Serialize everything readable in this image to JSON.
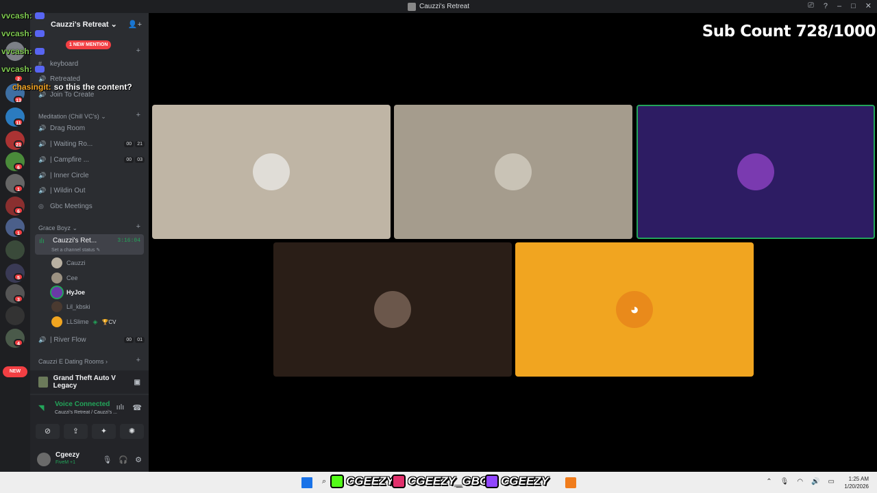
{
  "window": {
    "title": "Cauzzi's Retreat",
    "controls": [
      "⎚",
      "?",
      "–",
      "□",
      "✕"
    ]
  },
  "overlay": {
    "sub_count": "Sub Count 728/1000",
    "chat": [
      {
        "user": "vvcash:",
        "message": ""
      },
      {
        "user": "vvcash:",
        "message": ""
      },
      {
        "user": "vvcash:",
        "message": ""
      },
      {
        "user": "vvcash:",
        "message": ""
      },
      {
        "user": "chasingit:",
        "message": "so this the content?"
      }
    ]
  },
  "guild_sidebar": {
    "badges": [
      "2",
      "13",
      "11",
      "21",
      "6",
      "1",
      "6",
      "1",
      "5",
      "3",
      "4"
    ],
    "new_label": "NEW"
  },
  "server": {
    "name": "Cauzzi's Retreat ⌄",
    "new_mention": "1 NEW MENTION",
    "channels_top": [
      {
        "label": "keyboard"
      },
      {
        "label": "Retreated"
      },
      {
        "label": "Join To Create"
      }
    ],
    "category_meditation": "Meditation (Chill VC's) ⌄",
    "meditation_channels": [
      {
        "label": "Drag Room",
        "c1": "",
        "c2": ""
      },
      {
        "label": "| Waiting Ro...",
        "c1": "00",
        "c2": "21"
      },
      {
        "label": "| Campfire ...",
        "c1": "00",
        "c2": "03"
      },
      {
        "label": "| Inner Circle",
        "c1": "",
        "c2": ""
      },
      {
        "label": "| Wildin Out",
        "c1": "",
        "c2": ""
      },
      {
        "label": "Gbc Meetings",
        "c1": "",
        "c2": ""
      }
    ],
    "category_grace": "Grace Boyz ⌄",
    "active_channel": {
      "name": "Cauzzi's Ret...",
      "time": "3:16:04",
      "status": "Set a channel status ✎"
    },
    "members": [
      "Cauzzi",
      "Cee",
      "HyJoe",
      "Lil_kbski",
      "LLSlime"
    ],
    "member_extra": "🏆CV",
    "river_flow": {
      "label": "| River Flow",
      "c1": "00",
      "c2": "01"
    },
    "category_dating": "Cauzzi E Dating Rooms ›"
  },
  "game": {
    "name": "Grand Theft Auto V Legacy"
  },
  "voice": {
    "status": "Voice Connected",
    "location": "Cauzzi's Retreat / Cauzzi's ..."
  },
  "user": {
    "name": "Cgeezy",
    "activity": "FiveM +1"
  },
  "tiles": [
    {
      "color": "#bfb5a5",
      "avatar": "#e0ddd7"
    },
    {
      "color": "#a59c8d",
      "avatar": "#c9c3b6"
    },
    {
      "color": "#2d1c63",
      "avatar": "#7a3ab0"
    },
    {
      "color": "#2a1e17",
      "avatar": "#6b574b"
    },
    {
      "color": "#f1a520",
      "avatar": "#e98a1b"
    }
  ],
  "taskbar": {
    "brand1": "CGEEZY",
    "brand2": "CGEEZY_GBC",
    "brand3": "CGEEZY",
    "time": "1:25 AM",
    "date": "1/20/2026"
  }
}
